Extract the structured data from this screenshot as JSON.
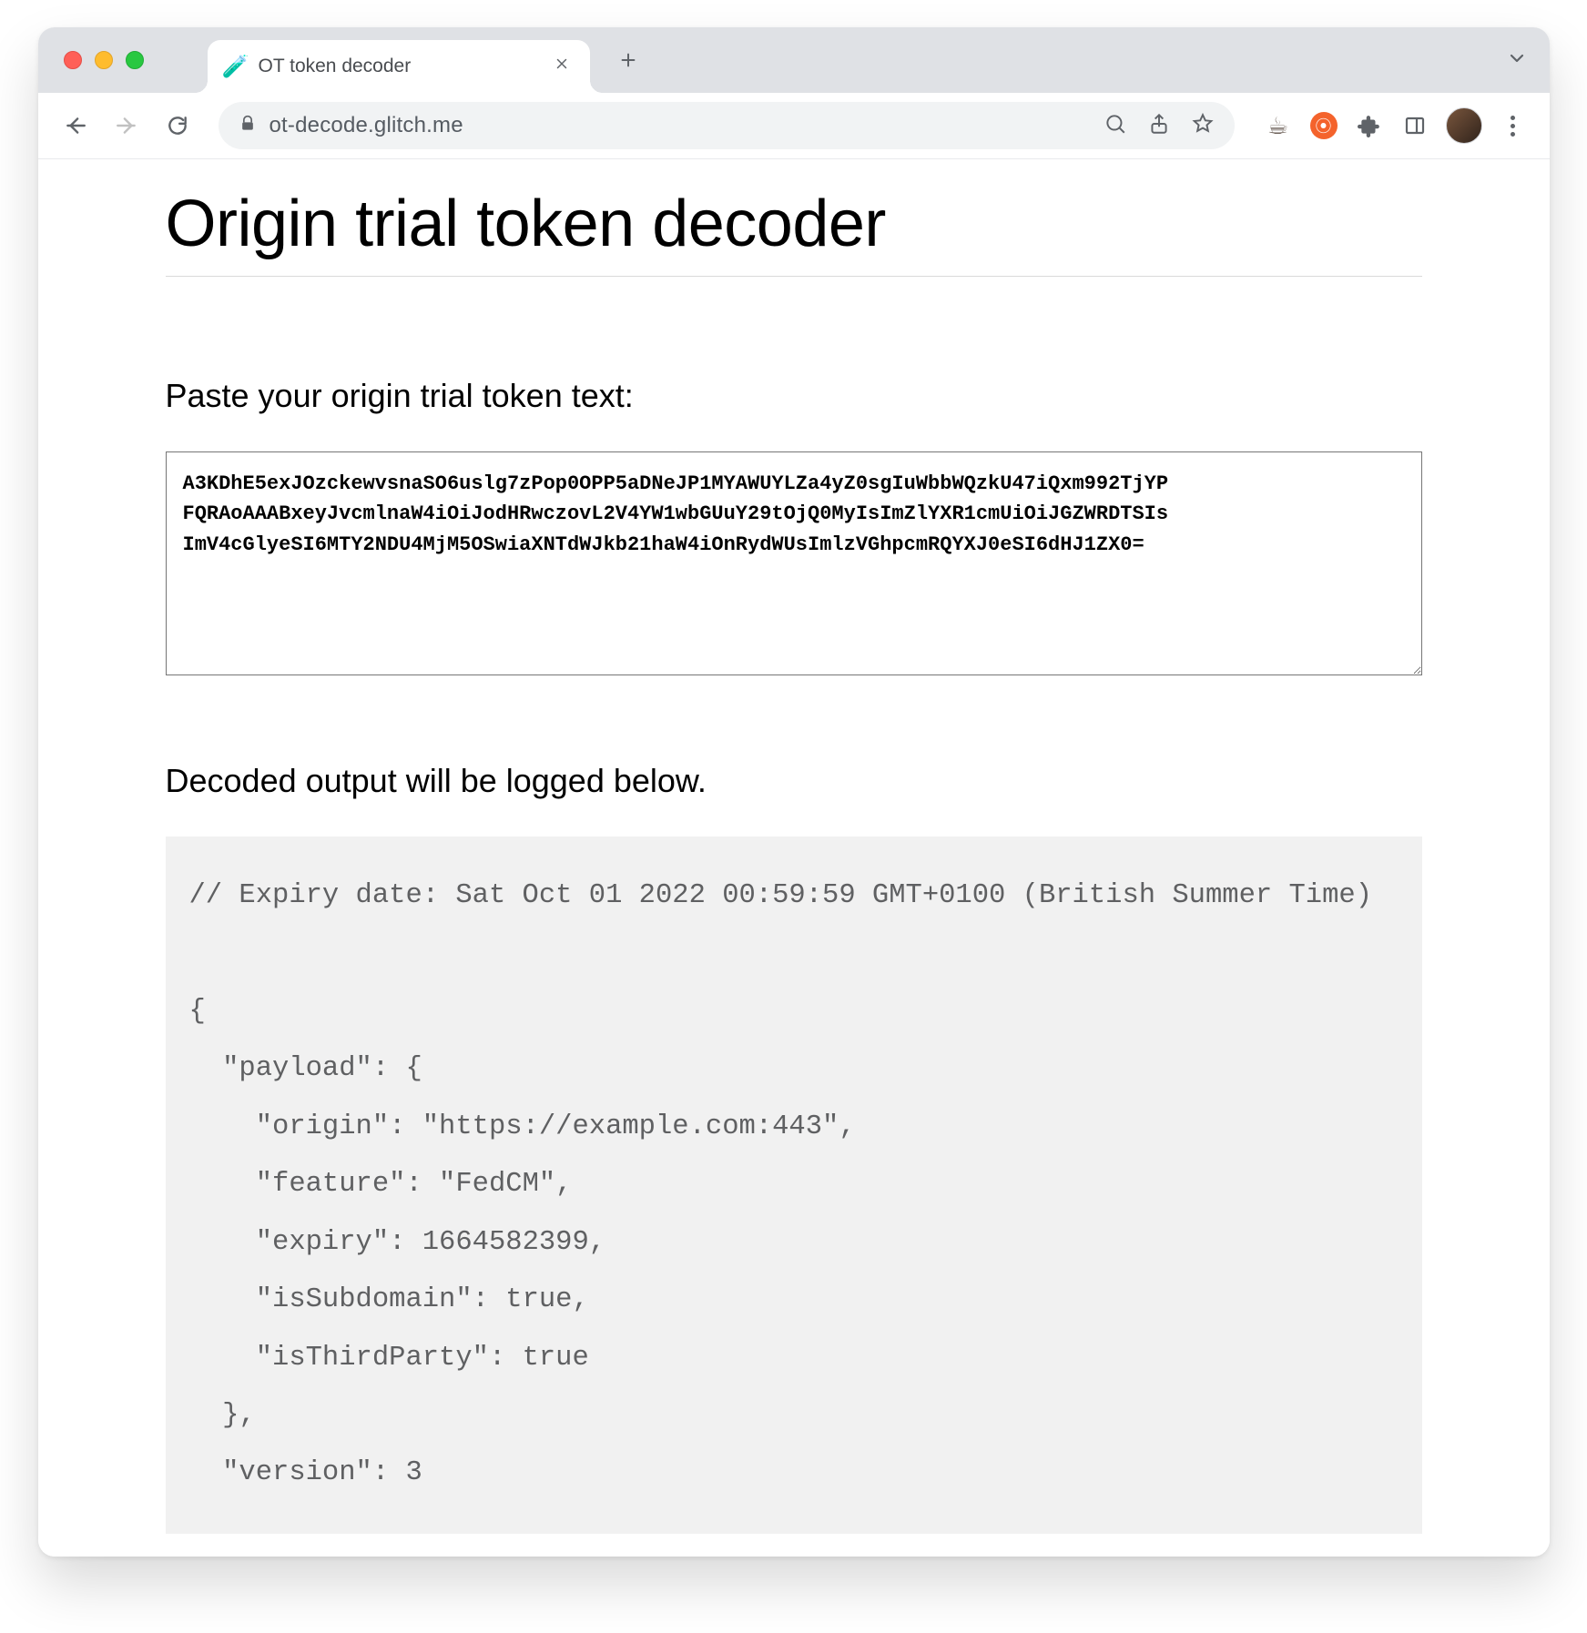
{
  "browser": {
    "tab_title": "OT token decoder",
    "url": "ot-decode.glitch.me"
  },
  "page": {
    "title": "Origin trial token decoder",
    "paste_label": "Paste your origin trial token text:",
    "token_value": "A3KDhE5exJOzckewvsnaSO6uslg7zPop0OPP5aDNeJP1MYAWUYLZa4yZ0sgIuWbbWQzkU47iQxm992TjYP\nFQRAoAAABxeyJvcmlnaW4iOiJodHRwczovL2V4YW1wbGUuY29tOjQ0MyIsImZlYXR1cmUiOiJGZWRDTSIs\nImV4cGlyeSI6MTY2NDU4MjM5OSwiaXNTdWJkb21haW4iOnRydWUsImlzVGhpcmRQYXJ0eSI6dHJ1ZX0=",
    "decoded_label": "Decoded output will be logged below.",
    "decoded_text": "// Expiry date: Sat Oct 01 2022 00:59:59 GMT+0100 (British Summer Time)\n\n{\n  \"payload\": {\n    \"origin\": \"https://example.com:443\",\n    \"feature\": \"FedCM\",\n    \"expiry\": 1664582399,\n    \"isSubdomain\": true,\n    \"isThirdParty\": true\n  },\n  \"version\": 3"
  },
  "decoded_json": {
    "expiry_date_comment": "Expiry date: Sat Oct 01 2022 00:59:59 GMT+0100 (British Summer Time)",
    "payload": {
      "origin": "https://example.com:443",
      "feature": "FedCM",
      "expiry": 1664582399,
      "isSubdomain": true,
      "isThirdParty": true
    },
    "version": 3
  }
}
